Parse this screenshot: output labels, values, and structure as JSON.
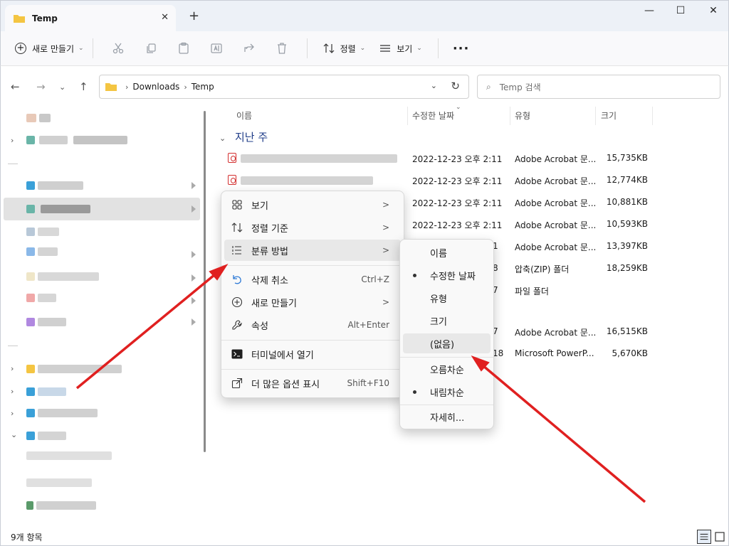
{
  "window": {
    "tab_title": "Temp",
    "tab_close": "✕",
    "new_tab": "+",
    "minimize": "—",
    "maximize": "☐",
    "close": "✕"
  },
  "toolbar": {
    "new_label": "새로 만들기",
    "sort_label": "정렬",
    "view_label": "보기",
    "more_label": "···"
  },
  "address": {
    "crumbs": [
      "Downloads",
      "Temp"
    ],
    "search_placeholder": "Temp 검색"
  },
  "columns": {
    "name": "이름",
    "date": "수정한 날짜",
    "type": "유형",
    "size": "크기"
  },
  "group_header": "지난 주",
  "rows": [
    {
      "date": "2022-12-23 오후 2:11",
      "type": "Adobe Acrobat 문...",
      "size": "15,735KB"
    },
    {
      "date": "2022-12-23 오후 2:11",
      "type": "Adobe Acrobat 문...",
      "size": "12,774KB"
    },
    {
      "date": "2022-12-23 오후 2:11",
      "type": "Adobe Acrobat 문...",
      "size": "10,881KB"
    },
    {
      "date": "2022-12-23 오후 2:11",
      "type": "Adobe Acrobat 문...",
      "size": "10,593KB"
    },
    {
      "date": "1",
      "type": "Adobe Acrobat 문...",
      "size": "13,397KB"
    },
    {
      "date": "8",
      "type": "압축(ZIP) 폴더",
      "size": "18,259KB"
    },
    {
      "date": "7",
      "type": "파일 폴더",
      "size": ""
    },
    {
      "date": "7",
      "type": "Adobe Acrobat 문...",
      "size": "16,515KB"
    },
    {
      "date": "18",
      "type": "Microsoft PowerP...",
      "size": "5,670KB"
    }
  ],
  "status": {
    "item_count": "9개 항목"
  },
  "context_menu": {
    "items": [
      {
        "label": "보기",
        "icon": "view-grid-icon",
        "trail": ">"
      },
      {
        "label": "정렬 기준",
        "icon": "sort-icon",
        "trail": ">"
      },
      {
        "label": "분류 방법",
        "icon": "group-by-icon",
        "trail": ">"
      },
      {
        "label": "삭제 취소",
        "icon": "undo-icon",
        "trail": "Ctrl+Z"
      },
      {
        "label": "새로 만들기",
        "icon": "new-plus-icon",
        "trail": ">"
      },
      {
        "label": "속성",
        "icon": "wrench-icon",
        "trail": "Alt+Enter"
      },
      {
        "label": "터미널에서 열기",
        "icon": "terminal-icon",
        "trail": ""
      },
      {
        "label": "더 많은 옵션 표시",
        "icon": "more-options-icon",
        "trail": "Shift+F10"
      }
    ]
  },
  "group_submenu": {
    "items": [
      {
        "label": "이름",
        "checked": false
      },
      {
        "label": "수정한 날짜",
        "checked": true
      },
      {
        "label": "유형",
        "checked": false
      },
      {
        "label": "크기",
        "checked": false
      },
      {
        "label": "(없음)",
        "checked": false,
        "highlighted": true
      },
      {
        "label": "오름차순",
        "checked": false
      },
      {
        "label": "내림차순",
        "checked": true
      },
      {
        "label": "자세히...",
        "checked": false
      }
    ]
  },
  "colors": {
    "accent": "#1f3c88",
    "folder": "#f4c542",
    "pdf": "#d32f2f",
    "annotation_arrow": "#e02020"
  }
}
